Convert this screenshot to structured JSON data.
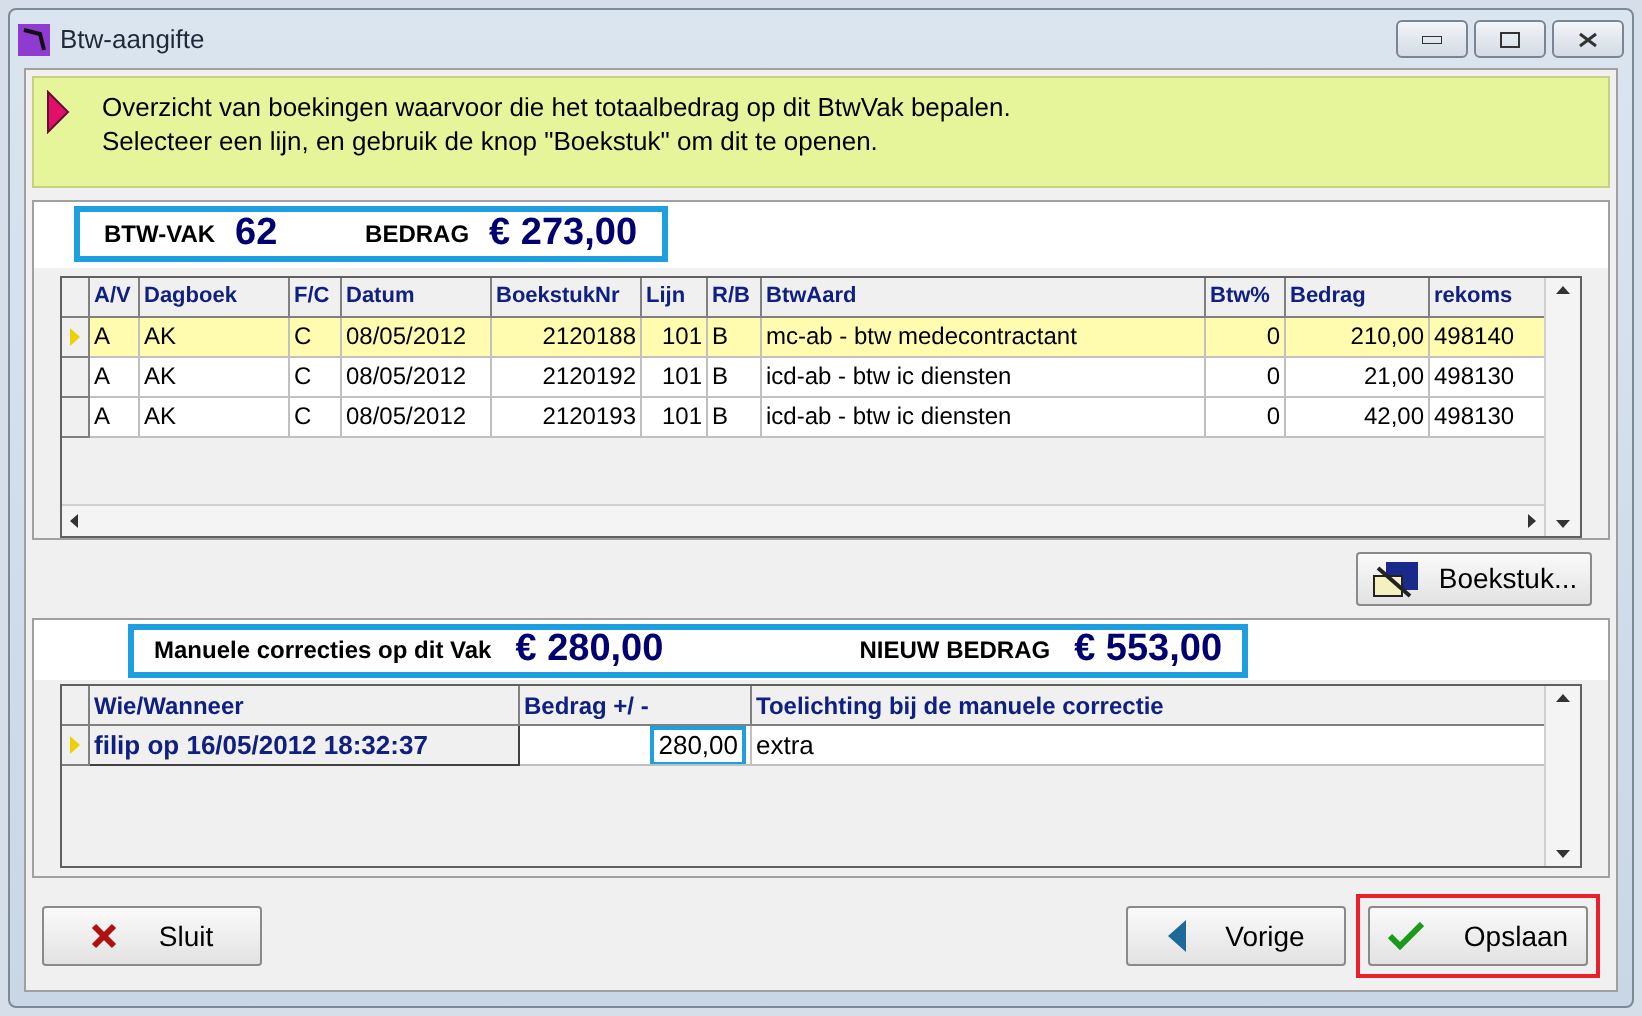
{
  "window": {
    "title": "Btw-aangifte"
  },
  "info": {
    "lines": [
      "Overzicht van boekingen waarvoor die het totaalbedrag op dit BtwVak bepalen.",
      "Selecteer een lijn, en gebruik de knop \"Boekstuk\" om dit te openen."
    ]
  },
  "summary": {
    "vak_label": "BTW-VAK",
    "vak": "62",
    "bedrag_label": "BEDRAG",
    "bedrag": "€ 273,00"
  },
  "bookings": {
    "columns": [
      "A/V",
      "Dagboek",
      "F/C",
      "Datum",
      "BoekstukNr",
      "Lijn",
      "R/B",
      "BtwAard",
      "Btw%",
      "Bedrag",
      "rekoms"
    ],
    "rows": [
      {
        "selected": true,
        "cells": [
          "A",
          "AK",
          "C",
          "08/05/2012",
          "2120188",
          "101",
          "B",
          "mc-ab - btw medecontractant",
          "0",
          "210,00",
          "498140"
        ]
      },
      {
        "selected": false,
        "cells": [
          "A",
          "AK",
          "C",
          "08/05/2012",
          "2120192",
          "101",
          "B",
          "icd-ab - btw ic diensten",
          "0",
          "21,00",
          "498130"
        ]
      },
      {
        "selected": false,
        "cells": [
          "A",
          "AK",
          "C",
          "08/05/2012",
          "2120193",
          "101",
          "B",
          "icd-ab - btw ic diensten",
          "0",
          "42,00",
          "498130"
        ]
      }
    ]
  },
  "boekstuk_button": "Boekstuk...",
  "corrections_summary": {
    "label": "Manuele correcties op dit Vak",
    "amount": "€ 280,00",
    "new_label": "NIEUW BEDRAG",
    "new_amount": "€ 553,00"
  },
  "corrections": {
    "columns": [
      "Wie/Wanneer",
      "Bedrag +/ -",
      "Toelichting bij de manuele correctie"
    ],
    "rows": [
      {
        "selected": true,
        "cells": [
          "filip op 16/05/2012 18:32:37",
          "280,00",
          "extra"
        ]
      }
    ]
  },
  "buttons": [
    {
      "kind": "close",
      "label": "Sluit"
    },
    {
      "kind": "previous",
      "label": "Vorige"
    },
    {
      "kind": "save",
      "label": "Opslaan",
      "highlighted": true
    }
  ]
}
